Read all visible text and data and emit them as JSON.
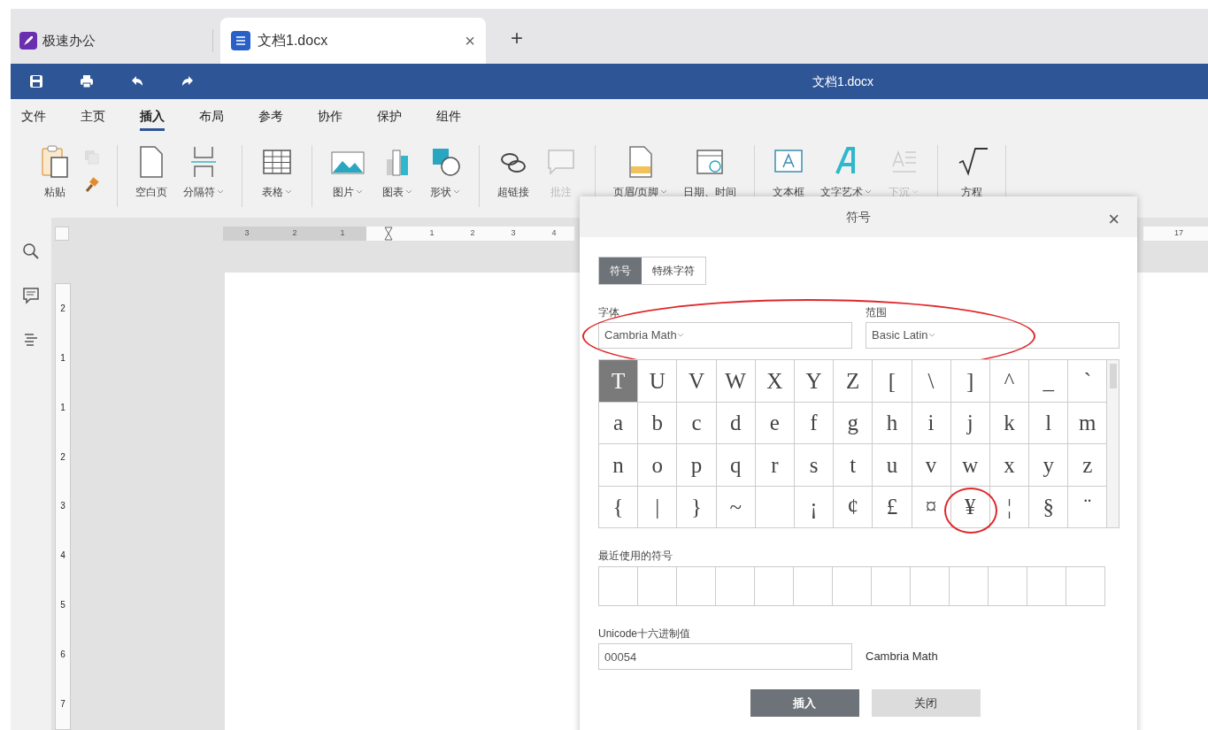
{
  "app_tab": {
    "title": "极速办公"
  },
  "doc_tab": {
    "title": "文档1.docx",
    "close": "×",
    "new": "+"
  },
  "title_bar": {
    "title": "文档1.docx"
  },
  "menu": [
    {
      "label": "文件",
      "selected": false
    },
    {
      "label": "主页",
      "selected": false
    },
    {
      "label": "插入",
      "selected": true
    },
    {
      "label": "布局",
      "selected": false
    },
    {
      "label": "参考",
      "selected": false
    },
    {
      "label": "协作",
      "selected": false
    },
    {
      "label": "保护",
      "selected": false
    },
    {
      "label": "组件",
      "selected": false
    }
  ],
  "ribbon": [
    [
      {
        "label": "粘贴",
        "dropdown": false,
        "disabled": false
      }
    ],
    [
      {
        "label": "空白页",
        "dropdown": false,
        "disabled": false
      },
      {
        "label": "分隔符",
        "dropdown": true,
        "disabled": false
      }
    ],
    [
      {
        "label": "表格",
        "dropdown": true,
        "disabled": false
      }
    ],
    [
      {
        "label": "图片",
        "dropdown": true,
        "disabled": false
      },
      {
        "label": "图表",
        "dropdown": true,
        "disabled": false
      },
      {
        "label": "形状",
        "dropdown": true,
        "disabled": false
      }
    ],
    [
      {
        "label": "超链接",
        "dropdown": false,
        "disabled": false
      },
      {
        "label": "批注",
        "dropdown": false,
        "disabled": true
      }
    ],
    [
      {
        "label": "页眉/页脚",
        "dropdown": true,
        "disabled": false
      },
      {
        "label": "日期、时间",
        "dropdown": false,
        "disabled": false
      }
    ],
    [
      {
        "label": "文本框",
        "dropdown": false,
        "disabled": false
      },
      {
        "label": "文字艺术",
        "dropdown": true,
        "disabled": false
      },
      {
        "label": "下沉",
        "dropdown": true,
        "disabled": true
      }
    ],
    [
      {
        "label": "方程",
        "dropdown": false,
        "disabled": false
      }
    ]
  ],
  "ruler": {
    "left_labels": [
      "3",
      "2",
      "1"
    ],
    "right_labels": [
      "1",
      "2",
      "3",
      "4"
    ],
    "far_labels": [
      "17"
    ]
  },
  "vertical_ruler": {
    "labels": [
      "2",
      "1",
      "1",
      "2",
      "3",
      "4",
      "5",
      "6",
      "7"
    ]
  },
  "dialog": {
    "title": "符号",
    "close": "×",
    "tabs": [
      {
        "label": "符号",
        "selected": true
      },
      {
        "label": "特殊字符",
        "selected": false
      }
    ],
    "font": {
      "label": "字体",
      "value": "Cambria Math"
    },
    "range": {
      "label": "范围",
      "value": "Basic Latin"
    },
    "fields_circled": true,
    "symbols": [
      {
        "char": "T",
        "selected": true,
        "circled": false
      },
      {
        "char": "U",
        "selected": false,
        "circled": false
      },
      {
        "char": "V",
        "selected": false,
        "circled": false
      },
      {
        "char": "W",
        "selected": false,
        "circled": false
      },
      {
        "char": "X",
        "selected": false,
        "circled": false
      },
      {
        "char": "Y",
        "selected": false,
        "circled": false
      },
      {
        "char": "Z",
        "selected": false,
        "circled": false
      },
      {
        "char": "[",
        "selected": false,
        "circled": false
      },
      {
        "char": "\\",
        "selected": false,
        "circled": false
      },
      {
        "char": "]",
        "selected": false,
        "circled": false
      },
      {
        "char": "^",
        "selected": false,
        "circled": false
      },
      {
        "char": "_",
        "selected": false,
        "circled": false
      },
      {
        "char": "`",
        "selected": false,
        "circled": false
      },
      {
        "char": "a",
        "selected": false,
        "circled": false
      },
      {
        "char": "b",
        "selected": false,
        "circled": false
      },
      {
        "char": "c",
        "selected": false,
        "circled": false
      },
      {
        "char": "d",
        "selected": false,
        "circled": false
      },
      {
        "char": "e",
        "selected": false,
        "circled": false
      },
      {
        "char": "f",
        "selected": false,
        "circled": false
      },
      {
        "char": "g",
        "selected": false,
        "circled": false
      },
      {
        "char": "h",
        "selected": false,
        "circled": false
      },
      {
        "char": "i",
        "selected": false,
        "circled": false
      },
      {
        "char": "j",
        "selected": false,
        "circled": false
      },
      {
        "char": "k",
        "selected": false,
        "circled": false
      },
      {
        "char": "l",
        "selected": false,
        "circled": false
      },
      {
        "char": "m",
        "selected": false,
        "circled": false
      },
      {
        "char": "n",
        "selected": false,
        "circled": false
      },
      {
        "char": "o",
        "selected": false,
        "circled": false
      },
      {
        "char": "p",
        "selected": false,
        "circled": false
      },
      {
        "char": "q",
        "selected": false,
        "circled": false
      },
      {
        "char": "r",
        "selected": false,
        "circled": false
      },
      {
        "char": "s",
        "selected": false,
        "circled": false
      },
      {
        "char": "t",
        "selected": false,
        "circled": false
      },
      {
        "char": "u",
        "selected": false,
        "circled": false
      },
      {
        "char": "v",
        "selected": false,
        "circled": false
      },
      {
        "char": "w",
        "selected": false,
        "circled": false
      },
      {
        "char": "x",
        "selected": false,
        "circled": false
      },
      {
        "char": "y",
        "selected": false,
        "circled": false
      },
      {
        "char": "z",
        "selected": false,
        "circled": false
      },
      {
        "char": "{",
        "selected": false,
        "circled": false
      },
      {
        "char": "|",
        "selected": false,
        "circled": false
      },
      {
        "char": "}",
        "selected": false,
        "circled": false
      },
      {
        "char": "~",
        "selected": false,
        "circled": false
      },
      {
        "selected": false,
        "circled": false
      },
      {
        "char": "¡",
        "selected": false,
        "circled": false
      },
      {
        "char": "¢",
        "selected": false,
        "circled": false
      },
      {
        "char": "£",
        "selected": false,
        "circled": false
      },
      {
        "char": "¤",
        "selected": false,
        "circled": false
      },
      {
        "char": "¥",
        "selected": false,
        "circled": true
      },
      {
        "char": "¦",
        "selected": false,
        "circled": false
      },
      {
        "char": "§",
        "selected": false,
        "circled": false
      },
      {
        "char": "¨",
        "selected": false,
        "circled": false
      }
    ],
    "recent_label": "最近使用的符号",
    "unicode": {
      "label": "Unicode十六进制值",
      "value": "00054",
      "font_name": "Cambria Math"
    },
    "buttons": [
      {
        "label": "插入",
        "kind": "primary"
      },
      {
        "label": "关闭",
        "kind": "secondary"
      }
    ]
  }
}
